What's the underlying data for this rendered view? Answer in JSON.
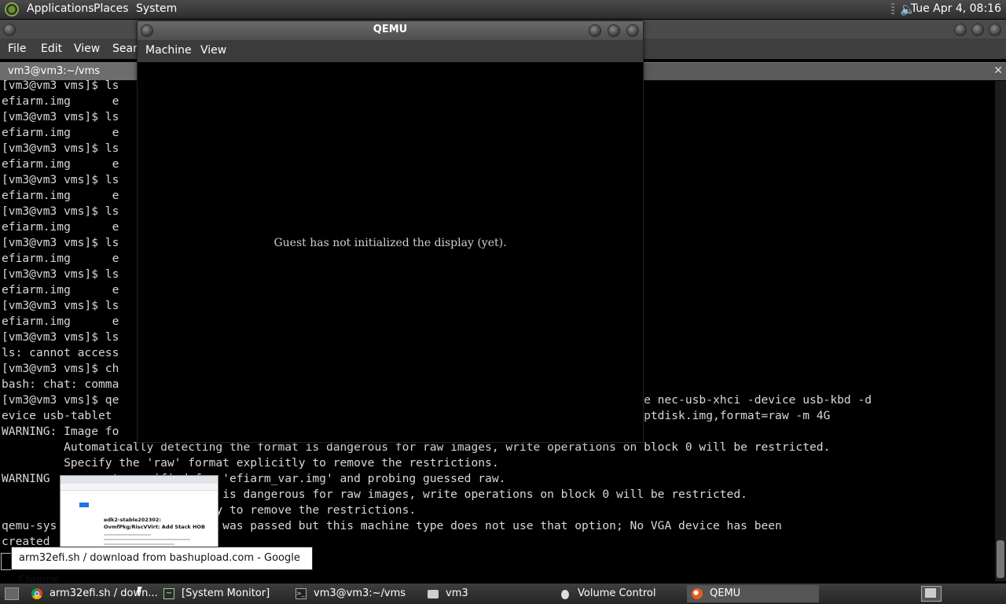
{
  "top_panel": {
    "menu": [
      "Applications",
      "Places",
      "System"
    ],
    "clock": "Tue Apr  4, 08:16",
    "logo_icon": "distro-logo-icon",
    "volume_icon": "speaker-icon"
  },
  "terminal": {
    "menu": [
      "File",
      "Edit",
      "View",
      "Search"
    ],
    "tab_title": "vm3@vm3:~/vms",
    "lines": [
      "[vm3@vm3 vms]$ ls",
      "efiarm.img      e",
      "[vm3@vm3 vms]$ ls",
      "efiarm.img      e",
      "[vm3@vm3 vms]$ ls",
      "efiarm.img      e",
      "[vm3@vm3 vms]$ ls",
      "efiarm.img      e",
      "[vm3@vm3 vms]$ ls",
      "efiarm.img      e",
      "[vm3@vm3 vms]$ ls",
      "efiarm.img      e",
      "[vm3@vm3 vms]$ ls",
      "efiarm.img      e",
      "[vm3@vm3 vms]$ ls",
      "efiarm.img      e",
      "[vm3@vm3 vms]$ ls",
      "ls: cannot access",
      "[vm3@vm3 vms]$ ch",
      "bash: chat: comma",
      "[vm3@vm3 vms]$ qe                                                                smp 2 -device nec-usb-xhci -device usb-kbd -d",
      "evice usb-tablet                                                                 drive file=gptdisk.img,format=raw -m 4G",
      "WARNING: Image fo",
      "         Automatically detecting the format is dangerous for raw images, write operations on block 0 will be restricted.",
      "         Specify the 'raw' format explicitly to remove the restrictions.",
      "WARNING        ot specified for 'efiarm_var.img' and probing guessed raw.",
      "               cting the format is dangerous for raw images, write operations on block 0 will be restricted.",
      "               format explicitly to remove the restrictions.",
      "qemu-sys       g: A -vga option was passed but this machine type does not use that option; No VGA device has been",
      "created"
    ]
  },
  "qemu": {
    "title": "QEMU",
    "menu": [
      "Machine",
      "View"
    ],
    "message": "Guest has not initialized the display (yet)."
  },
  "thumbnail": {
    "title": "edk2-stable202302: OvmfPkg/RiscVVirt: Add Stack HOB"
  },
  "tooltip": "arm32efi.sh / download from bashupload.com - Google Chrome",
  "taskbar": {
    "items": [
      {
        "label": "arm32efi.sh / down...",
        "icon": "chrome-icon"
      },
      {
        "label": "[System Monitor]",
        "icon": "system-monitor-icon"
      },
      {
        "label": "vm3@vm3:~/vms",
        "icon": "terminal-icon"
      },
      {
        "label": "vm3",
        "icon": "folder-icon"
      },
      {
        "label": "Volume Control",
        "icon": "volume-control-icon"
      },
      {
        "label": "QEMU",
        "icon": "qemu-icon"
      }
    ]
  }
}
